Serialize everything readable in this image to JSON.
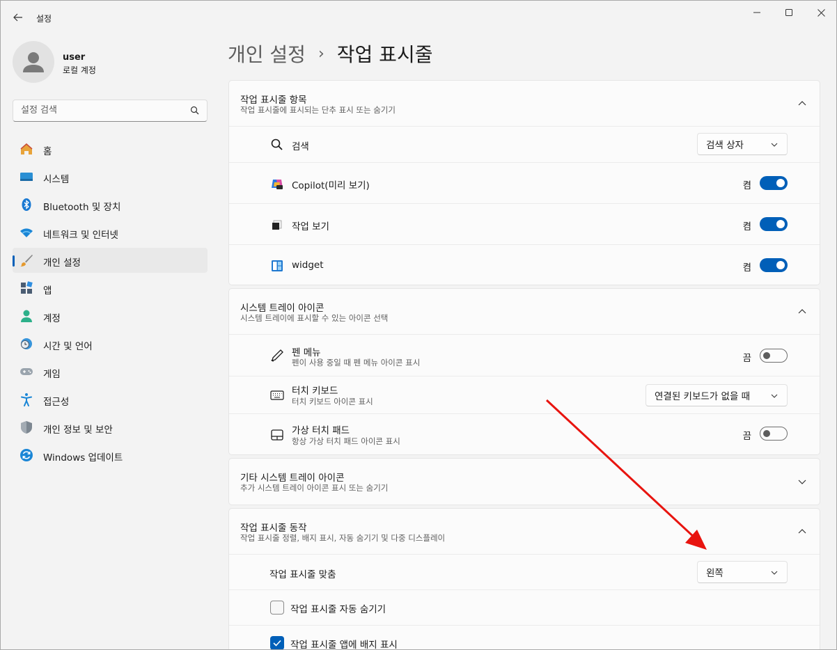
{
  "window": {
    "app_title": "설정",
    "accent": "#005fb8",
    "annotation_arrow_color": "#e8140f"
  },
  "user": {
    "name": "user",
    "account_type": "로컬 계정"
  },
  "search": {
    "placeholder": "설정 검색"
  },
  "sidebar": {
    "items": [
      {
        "label": "홈",
        "icon": "home-icon"
      },
      {
        "label": "시스템",
        "icon": "system-icon"
      },
      {
        "label": "Bluetooth 및 장치",
        "icon": "bluetooth-icon"
      },
      {
        "label": "네트워크 및 인터넷",
        "icon": "wifi-icon"
      },
      {
        "label": "개인 설정",
        "icon": "brush-icon",
        "active": true
      },
      {
        "label": "앱",
        "icon": "apps-icon"
      },
      {
        "label": "계정",
        "icon": "account-icon"
      },
      {
        "label": "시간 및 언어",
        "icon": "time-language-icon"
      },
      {
        "label": "게임",
        "icon": "gamepad-icon"
      },
      {
        "label": "접근성",
        "icon": "accessibility-icon"
      },
      {
        "label": "개인 정보 및 보안",
        "icon": "shield-icon"
      },
      {
        "label": "Windows 업데이트",
        "icon": "update-icon"
      }
    ]
  },
  "breadcrumb": {
    "parent": "개인 설정",
    "separator": "›",
    "current": "작업 표시줄"
  },
  "taskbar_items": {
    "title": "작업 표시줄 항목",
    "subtitle": "작업 표시줄에 표시되는 단추 표시 또는 숨기기",
    "search": {
      "label": "검색",
      "value": "검색 상자"
    },
    "copilot": {
      "label": "Copilot(미리 보기)",
      "state_label": "켬",
      "on": true
    },
    "task_view": {
      "label": "작업 보기",
      "state_label": "켬",
      "on": true
    },
    "widget": {
      "label": "widget",
      "state_label": "켬",
      "on": true
    }
  },
  "system_tray": {
    "title": "시스템 트레이 아이콘",
    "subtitle": "시스템 트레이에 표시할 수 있는 아이콘 선택",
    "pen_menu": {
      "label": "펜 메뉴",
      "sub": "펜이 사용 중일 때 펜 메뉴 아이콘 표시",
      "state_label": "끔",
      "on": false
    },
    "touch_keyboard": {
      "label": "터치 키보드",
      "sub": "터치 키보드 아이콘 표시",
      "value": "연결된 키보드가 없을 때"
    },
    "virtual_touchpad": {
      "label": "가상 터치 패드",
      "sub": "항상 가상 터치 패드 아이콘 표시",
      "state_label": "끔",
      "on": false
    }
  },
  "other_tray": {
    "title": "기타 시스템 트레이 아이콘",
    "subtitle": "추가 시스템 트레이 아이콘 표시 또는 숨기기"
  },
  "behaviors": {
    "title": "작업 표시줄 동작",
    "subtitle": "작업 표시줄 정렬, 배지 표시, 자동 숨기기 및 다중 디스플레이",
    "alignment": {
      "label": "작업 표시줄 맞춤",
      "value": "왼쪽"
    },
    "auto_hide": {
      "label": "작업 표시줄 자동 숨기기",
      "checked": false
    },
    "badges": {
      "label": "작업 표시줄 앱에 배지 표시",
      "checked": true
    }
  }
}
